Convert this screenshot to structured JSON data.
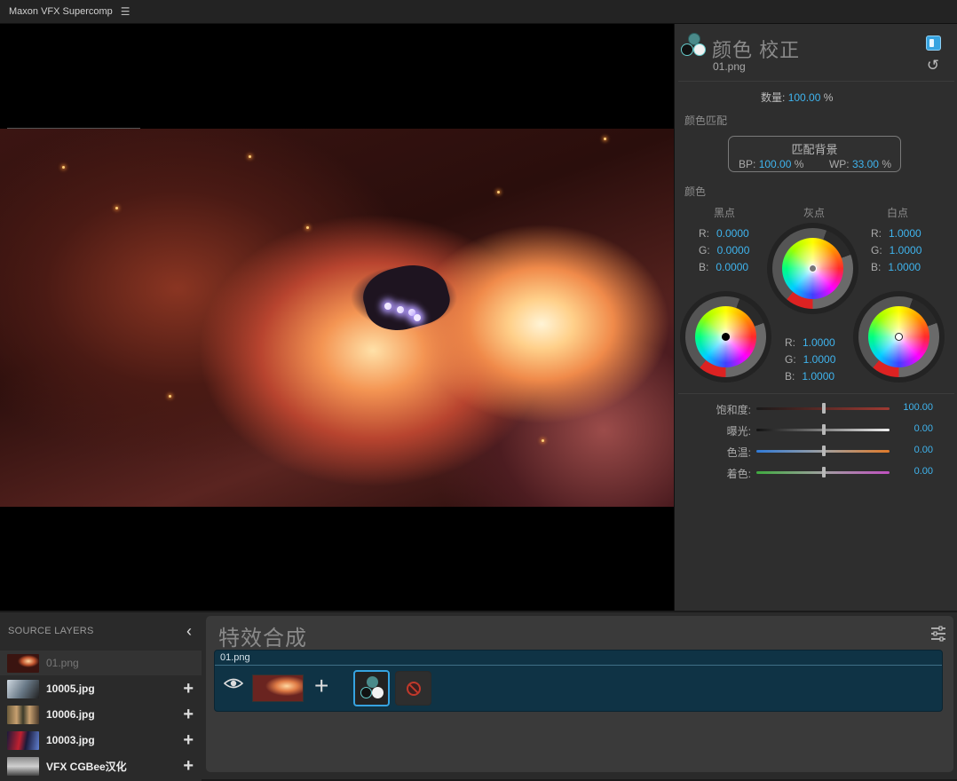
{
  "app": {
    "title": "Maxon VFX Supercomp",
    "menu_icon": "hamburger-icon"
  },
  "effect_panel": {
    "title": "颜色 校正",
    "layer_name": "01.png",
    "amount_label": "数量:",
    "amount_value": "100.00",
    "amount_unit": "%",
    "color_match_section": "颜色匹配",
    "match_button_label": "匹配背景",
    "bp_label": "BP:",
    "bp_value": "100.00",
    "bp_unit": "%",
    "wp_label": "WP:",
    "wp_value": "33.00",
    "wp_unit": "%",
    "color_section": "颜色",
    "black_point": {
      "label": "黑点",
      "r": "0.0000",
      "g": "0.0000",
      "b": "0.0000"
    },
    "gray_point": {
      "label": "灰点",
      "r": "1.0000",
      "g": "1.0000",
      "b": "1.0000"
    },
    "white_point": {
      "label": "白点",
      "r": "1.0000",
      "g": "1.0000",
      "b": "1.0000"
    },
    "channel_labels": {
      "r": "R:",
      "g": "G:",
      "b": "B:"
    },
    "sliders": [
      {
        "label": "饱和度:",
        "value": "100.00"
      },
      {
        "label": "曝光:",
        "value": "0.00"
      },
      {
        "label": "色温:",
        "value": "0.00"
      },
      {
        "label": "着色:",
        "value": "0.00"
      }
    ],
    "accent": "#3fb4ee"
  },
  "source_layers": {
    "header": "SOURCE LAYERS",
    "items": [
      {
        "name": "01.png",
        "active": true
      },
      {
        "name": "10005.jpg"
      },
      {
        "name": "10006.jpg"
      },
      {
        "name": "10003.jpg"
      },
      {
        "name": "VFX CGBee汉化"
      }
    ]
  },
  "composition": {
    "title": "特效合成",
    "layer_name": "01.png"
  }
}
